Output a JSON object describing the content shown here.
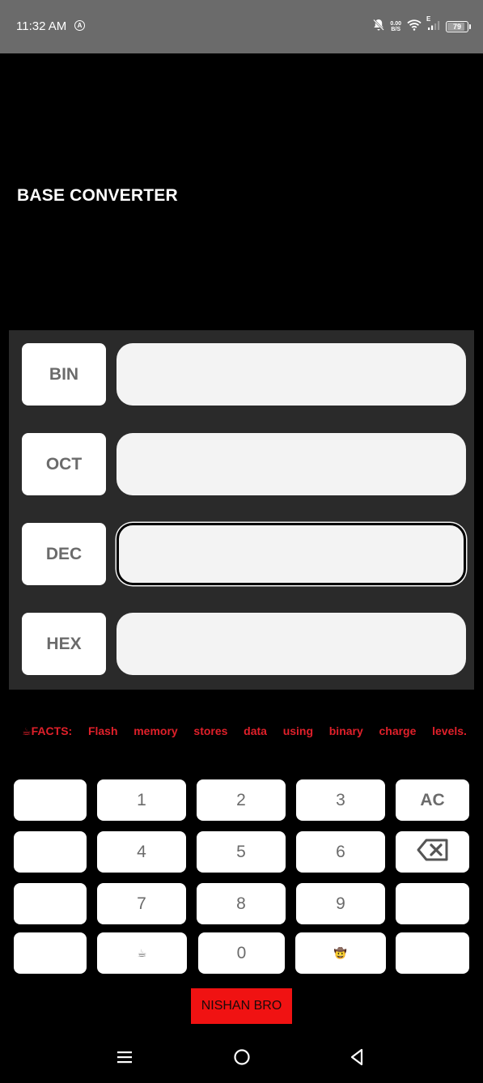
{
  "status_bar": {
    "time": "11:32 AM",
    "net_speed_value": "0.00",
    "net_speed_unit": "B/S",
    "network_type": "E",
    "battery": "79"
  },
  "app": {
    "title": "BASE CONVERTER"
  },
  "converter": {
    "rows": [
      {
        "label": "BIN",
        "value": "",
        "placeholder": ""
      },
      {
        "label": "OCT",
        "value": "",
        "placeholder": ""
      },
      {
        "label": "DEC",
        "value": "",
        "placeholder": ""
      },
      {
        "label": "HEX",
        "value": "",
        "placeholder": ""
      }
    ]
  },
  "facts": {
    "prefix_icon": "☕",
    "label": "FACTS:",
    "words": [
      "Flash",
      "memory",
      "stores",
      "data",
      "using",
      "binary",
      "charge",
      "levels."
    ]
  },
  "keypad": {
    "keys": [
      "",
      "1",
      "2",
      "3",
      "AC",
      "",
      "4",
      "5",
      "6",
      "backspace-icon",
      "",
      "7",
      "8",
      "9",
      "",
      "",
      "☕",
      "0",
      "🤠",
      ""
    ]
  },
  "credit_button": {
    "label": "NISHAN BRO"
  },
  "colors": {
    "accent_red": "#e0202a",
    "button_red": "#f01212",
    "panel_bg": "#2a2a2a",
    "status_bar_bg": "#6b6b6b"
  }
}
